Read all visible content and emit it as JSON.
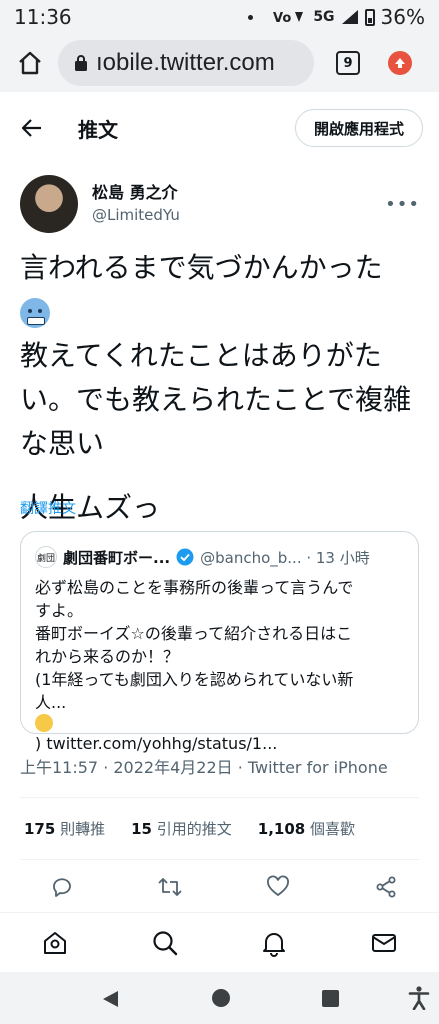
{
  "status_bar": {
    "time": "11:36",
    "network": "5G",
    "battery": "36%"
  },
  "browser": {
    "url": "mobile.twitter.com",
    "url_visible": "ıobile.twitter.com",
    "tab_count": "9",
    "icons": [
      "home-icon",
      "lock-icon",
      "tabs-icon",
      "update-icon"
    ]
  },
  "header": {
    "title": "推文",
    "open_app_label": "開啟應用程式"
  },
  "tweet": {
    "author_name": "松島 勇之介",
    "author_handle": "@LimitedYu",
    "more_label": "•••",
    "text_lines": [
      "言われるまで気づかんかった",
      "教えてくれたことはありがた",
      "い。でも教えられたことで複雑",
      "な思い",
      "人生ムズっ"
    ],
    "translate_label": "翻譯推文",
    "timestamp": "上午11:57 · 2022年4月22日 · Twitter for iPhone"
  },
  "quote": {
    "logo_text": "劇団",
    "name": "劇団番町ボー...",
    "handle_time": "@bancho_b... · 13 小時",
    "lines": [
      "必ず松島のことを事務所の後輩って言うんで",
      "すよ。",
      "番町ボーイズ☆の後輩って紹介される日はこ",
      "れから来るのか！？",
      "(1年経っても劇団入りを認められていない新",
      "人...",
      ") twitter.com/yohhg/status/1..."
    ]
  },
  "stats": {
    "retweets_count": "175",
    "retweets_label": "則轉推",
    "quotes_count": "15",
    "quotes_label": "引用的推文",
    "likes_count": "1,108",
    "likes_label": "個喜歡"
  },
  "colors": {
    "accent": "#1d9bf0",
    "text": "#0f1419",
    "secondary": "#536471",
    "update_badge": "#e8533f"
  }
}
